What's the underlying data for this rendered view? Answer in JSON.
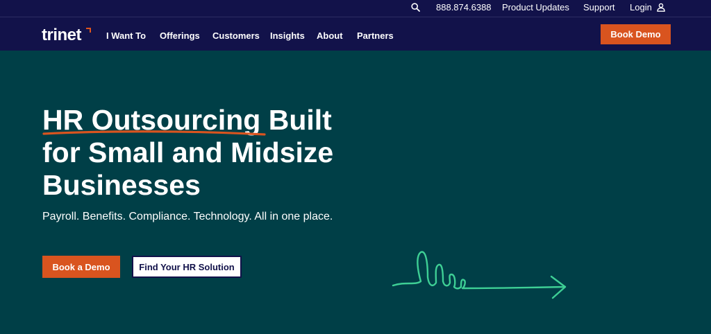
{
  "utility": {
    "phone": "888.874.6388",
    "product_updates": "Product Updates",
    "support": "Support",
    "login": "Login"
  },
  "icons": {
    "search": "search-icon",
    "user": "user-icon",
    "arrow": "squiggle-arrow-icon"
  },
  "brand": {
    "logo": "trinet",
    "accent": "#d9541f",
    "header_bg": "#12124a",
    "hero_bg": "#003f47",
    "line_color": "#3ecf95"
  },
  "nav": {
    "items": [
      "I Want To",
      "Offerings",
      "Customers",
      "Insights",
      "About",
      "Partners"
    ],
    "cta": "Book Demo"
  },
  "hero": {
    "title_highlight": "HR Outsourcing",
    "title_rest": " Built for Small and Midsize Businesses",
    "subtitle": "Payroll. Benefits. Compliance. Technology. All in one place.",
    "primary_cta": "Book a Demo",
    "secondary_cta": "Find Your HR Solution"
  }
}
